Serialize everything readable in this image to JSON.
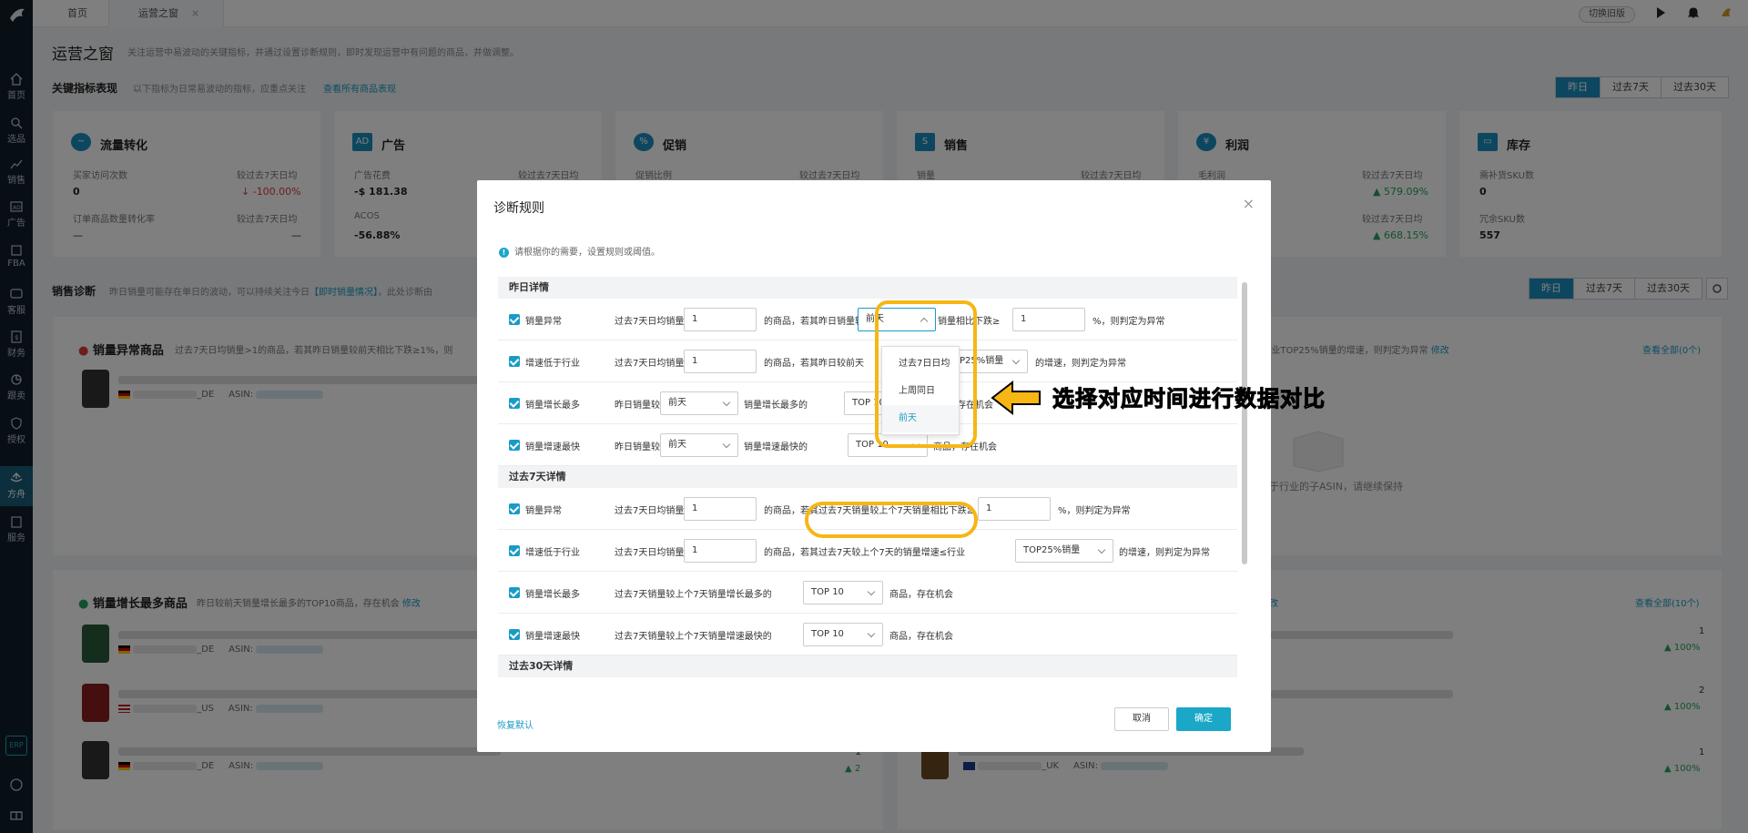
{
  "top_tabs": [
    {
      "label": "首页"
    },
    {
      "label": "运营之窗"
    }
  ],
  "top_right": {
    "switch_old": "切换旧版"
  },
  "sidebar": {
    "items": [
      {
        "label": "首页"
      },
      {
        "label": "选品"
      },
      {
        "label": "销售"
      },
      {
        "label": "广告"
      },
      {
        "label": "FBA"
      },
      {
        "label": "客服"
      },
      {
        "label": "财务"
      },
      {
        "label": "跟卖"
      },
      {
        "label": "授权"
      },
      {
        "label": "方舟"
      },
      {
        "label": "服务"
      }
    ],
    "erp": "ERP"
  },
  "page": {
    "title": "运营之窗",
    "desc": "关注运营中易波动的关键指标，并通过设置诊断规则，即时发现运营中有问题的商品，并做调整。"
  },
  "kpi": {
    "title": "关键指标表现",
    "desc": "以下指标为日常易波动的指标，应重点关注",
    "link": "查看所有商品表现",
    "ranges": [
      "昨日",
      "过去7天",
      "过去30天"
    ]
  },
  "cards": [
    {
      "title": "流量转化",
      "icon": "~",
      "r1_label": "买家访问次数",
      "r1_cmp": "较过去7天日均",
      "r1_value": "0",
      "r1_delta": "-100.00%",
      "r2_label": "订单商品数量转化率",
      "r2_cmp": "较过去7天日均",
      "r2_value": "—",
      "r2_delta": "—"
    },
    {
      "title": "广告",
      "icon": "AD",
      "r1_label": "广告花费",
      "r1_cmp": "较过去7天日均",
      "r1_value": "-$ 181.38",
      "r2_label": "ACOS",
      "r2_value": "-56.88%"
    },
    {
      "title": "促销",
      "icon": "%",
      "r1_label": "促销比例",
      "r1_cmp": "较过去7天日均"
    },
    {
      "title": "销售",
      "icon": "S",
      "r1_label": "销量",
      "r1_cmp": "较过去7天日均"
    },
    {
      "title": "利润",
      "icon": "¥",
      "r1_label": "毛利润",
      "r1_cmp": "较过去7天日均",
      "r1_delta": "579.09%",
      "r2_cmp": "较过去7天日均",
      "r2_delta": "668.15%"
    },
    {
      "title": "库存",
      "icon": "▭",
      "r1_label": "需补货SKU数",
      "r1_value": "0",
      "r2_label": "冗余SKU数",
      "r2_value": "557"
    }
  ],
  "diag": {
    "title": "销售诊断",
    "desc": "昨日销量可能存在单日的波动，可以持续关注今日",
    "link": "【即时销量情况】",
    "desc2": "，此处诊断由",
    "ranges": [
      "昨日",
      "过去7天",
      "过去30天"
    ]
  },
  "abnormal": {
    "title": "销量异常商品",
    "desc": "过去7天日均销量>1的商品，若其昨日销量较前天相比下跌≥1%，则",
    "right_text": "速≤行业TOP25%销量的增速，则判定为异常",
    "edit": "修改",
    "view_all": "查看全部(0个)",
    "empty_text": "于行业的子ASIN，请继续保持",
    "asin_label": "ASIN:",
    "row_suffix": "_DE"
  },
  "growth": {
    "title": "销量增长最多商品",
    "desc": "昨日较前天销量增长最多的TOP10商品，存在机会",
    "edit": "修改",
    "right_edit": "改",
    "view_all": "查看全部(10个)",
    "rows": [
      {
        "suffix": "_DE",
        "asin_label": "ASIN:",
        "count": "",
        "pct": ""
      },
      {
        "suffix": "_US",
        "asin_label": "ASIN:",
        "count": "",
        "pct": ""
      },
      {
        "suffix": "_DE",
        "asin_label": "ASIN:",
        "count": "2",
        "pct": "2"
      }
    ],
    "right_rows": [
      {
        "count": "1",
        "pct": "100%"
      },
      {
        "count": "2",
        "pct": "100%"
      },
      {
        "count": "1",
        "pct": "100%",
        "suffix": "_UK",
        "asin_label": "ASIN:"
      }
    ]
  },
  "modal": {
    "title": "诊断规则",
    "hint": "请根据你的需要，设置规则或阈值。",
    "sections": [
      "昨日详情",
      "过去7天详情",
      "过去30天详情"
    ],
    "rules": {
      "y1": {
        "name": "销量异常",
        "t1": "过去7天日均销量>",
        "v1": "1",
        "t2": "的商品，若其昨日销量较",
        "sel": "前天",
        "t3": "销量相比下跌≥",
        "v2": "1",
        "t4": "%，则判定为异常"
      },
      "y2": {
        "name": "增速低于行业",
        "t1": "过去7天日均销量>",
        "v1": "1",
        "t2": "的商品，若其昨日较前天",
        "sel": "TOP25%销量",
        "t3": "的增速，则判定为异常"
      },
      "y3": {
        "name": "销量增长最多",
        "t1": "昨日销量较",
        "sel1": "前天",
        "t2": "销量增长最多的",
        "sel2": "TOP 10",
        "t3": "商品，存在机会"
      },
      "y4": {
        "name": "销量增速最快",
        "t1": "昨日销量较",
        "sel1": "前天",
        "t2": "销量增速最快的",
        "sel2": "TOP 10",
        "t3": "商品，存在机会"
      },
      "w1": {
        "name": "销量异常",
        "t1": "过去7天日均销量>",
        "v1": "1",
        "t2": "的商品，若其过去7天销量较上个7天销量相比下跌≥",
        "v2": "1",
        "t3": "%，则判定为异常"
      },
      "w2": {
        "name": "增速低于行业",
        "t1": "过去7天日均销量>",
        "v1": "1",
        "t2": "的商品，若其过去7天较上个7天的销量增速≤行业",
        "sel": "TOP25%销量",
        "t3": "的增速，则判定为异常"
      },
      "w3": {
        "name": "销量增长最多",
        "t1": "过去7天销量较上个7天销量增长最多的",
        "sel": "TOP 10",
        "t2": "商品，存在机会"
      },
      "w4": {
        "name": "销量增速最快",
        "t1": "过去7天销量较上个7天销量增速最快的",
        "sel": "TOP 10",
        "t2": "商品，存在机会"
      }
    },
    "dropdown": [
      "过去7日日均",
      "上周同日",
      "前天"
    ],
    "restore": "恢复默认",
    "cancel": "取消",
    "ok": "确定"
  },
  "callout": "选择对应时间进行数据对比",
  "colors": {
    "accent": "#1a9bc7",
    "highlight": "#f6b614",
    "up": "#22a35a",
    "down": "#e0373b"
  }
}
